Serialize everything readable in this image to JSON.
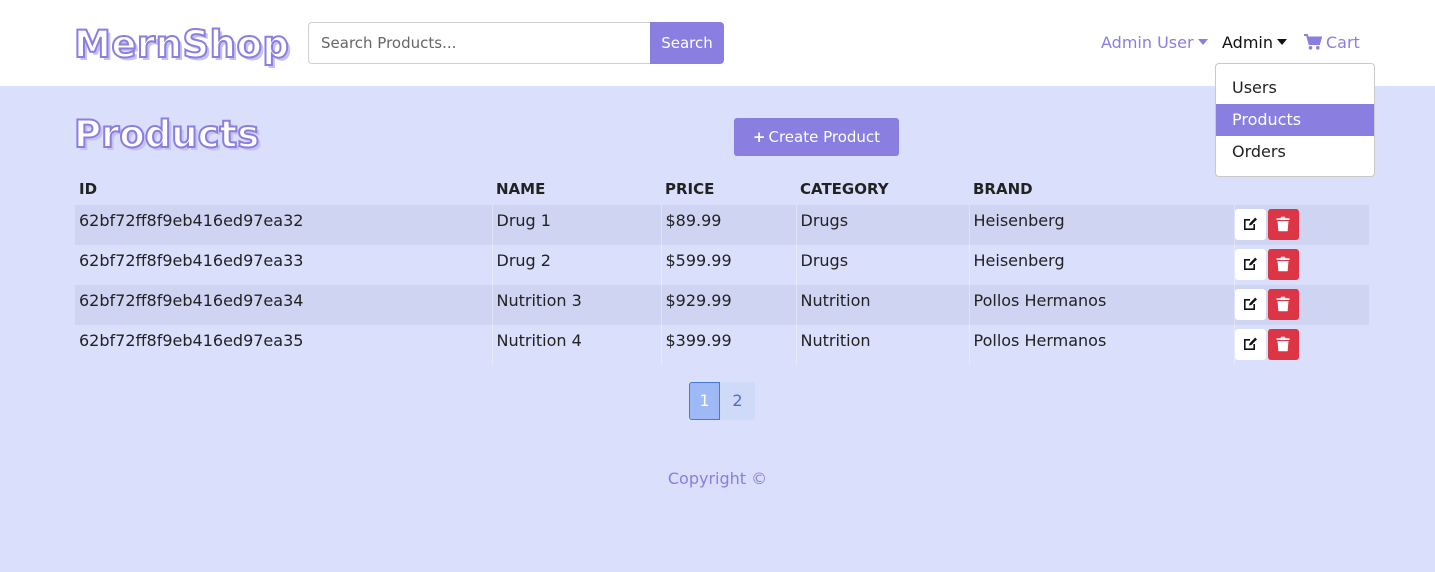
{
  "brand": {
    "name": "MernShop"
  },
  "search": {
    "placeholder": "Search Products...",
    "button_label": "Search"
  },
  "nav": {
    "user_label": "Admin User",
    "admin_label": "Admin",
    "cart_label": "Cart",
    "cart_icon": "shopping-cart-icon"
  },
  "admin_menu": {
    "items": [
      {
        "label": "Users",
        "active": false
      },
      {
        "label": "Products",
        "active": true
      },
      {
        "label": "Orders",
        "active": false
      }
    ]
  },
  "page": {
    "title": "Products",
    "create_label": "Create Product"
  },
  "table": {
    "headers": [
      "ID",
      "NAME",
      "PRICE",
      "CATEGORY",
      "BRAND"
    ],
    "rows": [
      {
        "id": "62bf72ff8f9eb416ed97ea32",
        "name": "Drug 1",
        "price": "$89.99",
        "category": "Drugs",
        "brand": "Heisenberg"
      },
      {
        "id": "62bf72ff8f9eb416ed97ea33",
        "name": "Drug 2",
        "price": "$599.99",
        "category": "Drugs",
        "brand": "Heisenberg"
      },
      {
        "id": "62bf72ff8f9eb416ed97ea34",
        "name": "Nutrition 3",
        "price": "$929.99",
        "category": "Nutrition",
        "brand": "Pollos Hermanos"
      },
      {
        "id": "62bf72ff8f9eb416ed97ea35",
        "name": "Nutrition 4",
        "price": "$399.99",
        "category": "Nutrition",
        "brand": "Pollos Hermanos"
      }
    ]
  },
  "pagination": {
    "pages": [
      "1",
      "2"
    ],
    "current": "1"
  },
  "footer": {
    "text": "Copyright ©"
  },
  "colors": {
    "accent": "#8a7ee0",
    "background": "#dadffc",
    "danger": "#dc3545"
  }
}
